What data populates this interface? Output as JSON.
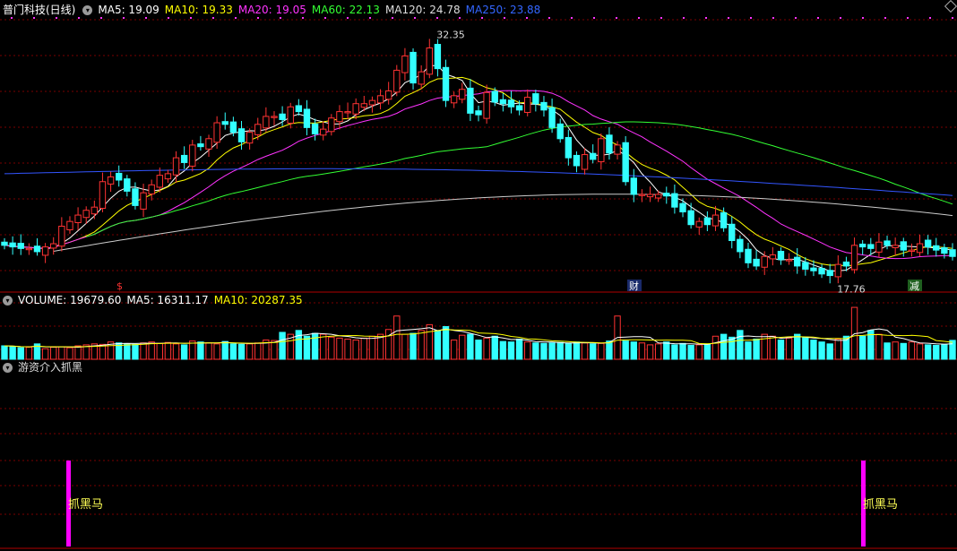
{
  "header": {
    "title": "普门科技(日线)",
    "indicators": [
      {
        "label": "MA5: 19.09",
        "color": "#ffffff"
      },
      {
        "label": "MA10: 19.33",
        "color": "#ffff00"
      },
      {
        "label": "MA20: 19.05",
        "color": "#ff33ff"
      },
      {
        "label": "MA60: 22.13",
        "color": "#33ff33"
      },
      {
        "label": "MA120: 24.78",
        "color": "#dddddd"
      },
      {
        "label": "MA250: 23.88",
        "color": "#3366ff"
      }
    ]
  },
  "volume_header": {
    "label": "VOLUME: 19679.60",
    "ma5": "MA5: 16311.17",
    "ma10": "MA10: 20287.35"
  },
  "indicator_header": {
    "label": "游资介入抓黑"
  },
  "markers": {
    "high": "32.35",
    "low": "17.76",
    "event_left": "$",
    "event_mid": "财",
    "event_right": "减"
  },
  "signals": {
    "label": "抓黑马",
    "color": "#ff00ff"
  },
  "colors": {
    "up": "#ff3333",
    "down": "#33ffff",
    "grid": "#7a0000",
    "bg": "#000000"
  },
  "chart_data": [
    {
      "type": "candlestick",
      "title": "普门科技(日线)",
      "ylim": [
        16.5,
        33.5
      ],
      "high": 32.35,
      "low": 17.76,
      "close": [
        19.1,
        19.0,
        18.9,
        18.9,
        18.7,
        19.0,
        19.2,
        20.3,
        20.6,
        21.0,
        21.3,
        21.5,
        23.1,
        23.4,
        23.2,
        22.5,
        21.6,
        22.4,
        22.9,
        23.5,
        23.6,
        24.6,
        24.3,
        25.4,
        25.3,
        25.8,
        26.8,
        26.7,
        26.2,
        25.6,
        26.2,
        26.7,
        27.2,
        27.2,
        27.0,
        27.8,
        27.5,
        26.5,
        26.1,
        26.4,
        27.1,
        27.5,
        27.5,
        28.0,
        28.0,
        28.2,
        28.5,
        28.8,
        30.1,
        31.0,
        29.3,
        30.0,
        31.5,
        30.2,
        28.2,
        28.5,
        28.9,
        27.4,
        27.3,
        28.7,
        28.1,
        28.0,
        27.8,
        27.6,
        28.4,
        28.0,
        27.6,
        26.5,
        25.8,
        24.6,
        24.1,
        24.8,
        24.5,
        25.8,
        24.9,
        25.4,
        23.1,
        22.3,
        22.3,
        22.3,
        22.3,
        22.2,
        21.5,
        21.2,
        20.4,
        20.6,
        20.4,
        21.0,
        20.2,
        19.4,
        18.7,
        18.0,
        17.8,
        18.4,
        18.5,
        18.2,
        18.2,
        17.8,
        17.6,
        17.5,
        17.3,
        17.2,
        17.9,
        17.8,
        19.1,
        19.0,
        18.9,
        19.3,
        19.1,
        19.1,
        18.8,
        18.8,
        19.2,
        19.0,
        18.8,
        18.6,
        18.4
      ],
      "series": [
        {
          "name": "MA5",
          "value": 19.09
        },
        {
          "name": "MA10",
          "value": 19.33
        },
        {
          "name": "MA20",
          "value": 19.05
        },
        {
          "name": "MA60",
          "value": 22.13
        },
        {
          "name": "MA120",
          "value": 24.78
        },
        {
          "name": "MA250",
          "value": 23.88
        }
      ]
    },
    {
      "type": "bar",
      "title": "VOLUME",
      "value": 19679.6,
      "ma5": 16311.17,
      "ma10": 20287.35,
      "values": [
        14000,
        13500,
        12000,
        12500,
        16000,
        11000,
        12500,
        13000,
        12000,
        14000,
        15000,
        16000,
        15500,
        18000,
        17000,
        16000,
        15500,
        17000,
        18000,
        16500,
        17500,
        16000,
        15000,
        19000,
        18000,
        17000,
        16000,
        18500,
        16000,
        15500,
        16000,
        17000,
        20000,
        19500,
        28000,
        26000,
        30000,
        24000,
        27000,
        26000,
        23000,
        22000,
        21000,
        20000,
        22000,
        24000,
        26000,
        31000,
        45000,
        26000,
        27000,
        30000,
        36000,
        30000,
        34000,
        20000,
        25000,
        26000,
        20000,
        22000,
        24000,
        18500,
        18000,
        21000,
        18000,
        17000,
        16500,
        17000,
        17500,
        16500,
        18000,
        17000,
        16000,
        16500,
        19000,
        45000,
        19000,
        18000,
        17000,
        15000,
        16000,
        18000,
        15000,
        16500,
        14500,
        15000,
        16000,
        24000,
        26000,
        23000,
        30000,
        18000,
        21000,
        26000,
        24000,
        20000,
        22000,
        26000,
        23000,
        20000,
        18000,
        16000,
        21000,
        24000,
        54000,
        24000,
        30000,
        26000,
        17000,
        18000,
        16500,
        18000,
        16000,
        15000,
        14500,
        15500,
        19679.6
      ]
    },
    {
      "type": "bar",
      "title": "游资介入抓黑",
      "signal_label": "抓黑马",
      "signal_index": [
        0,
        1
      ]
    }
  ]
}
